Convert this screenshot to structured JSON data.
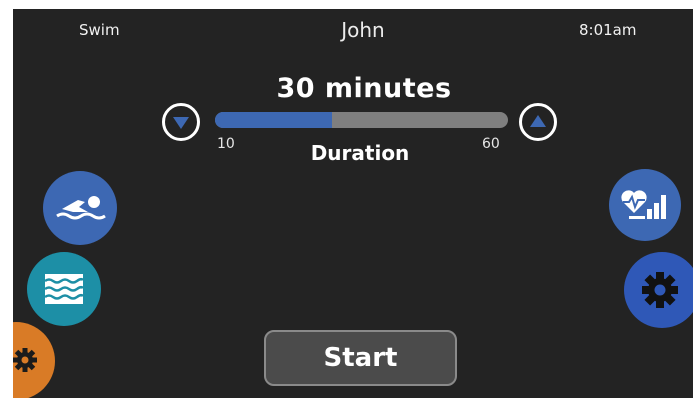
{
  "header": {
    "mode": "Swim",
    "user": "John",
    "time": "8:01am"
  },
  "duration": {
    "value_label": "30 minutes",
    "caption": "Duration",
    "min_label": "10",
    "max_label": "60",
    "current": 30,
    "min": 10,
    "max": 60
  },
  "controls": {
    "start_label": "Start",
    "decrease_icon": "triangle-down-icon",
    "increase_icon": "triangle-up-icon"
  },
  "side_buttons": {
    "left": [
      "swimmer-icon",
      "water-waves-icon",
      "gear-icon"
    ],
    "right": [
      "heart-rate-chart-icon",
      "gear-icon"
    ]
  },
  "colors": {
    "background": "#232323",
    "accent_blue": "#3d68b3",
    "teal": "#1d8fa6",
    "orange": "#d97b26",
    "track_gray": "#7f7f7f"
  }
}
